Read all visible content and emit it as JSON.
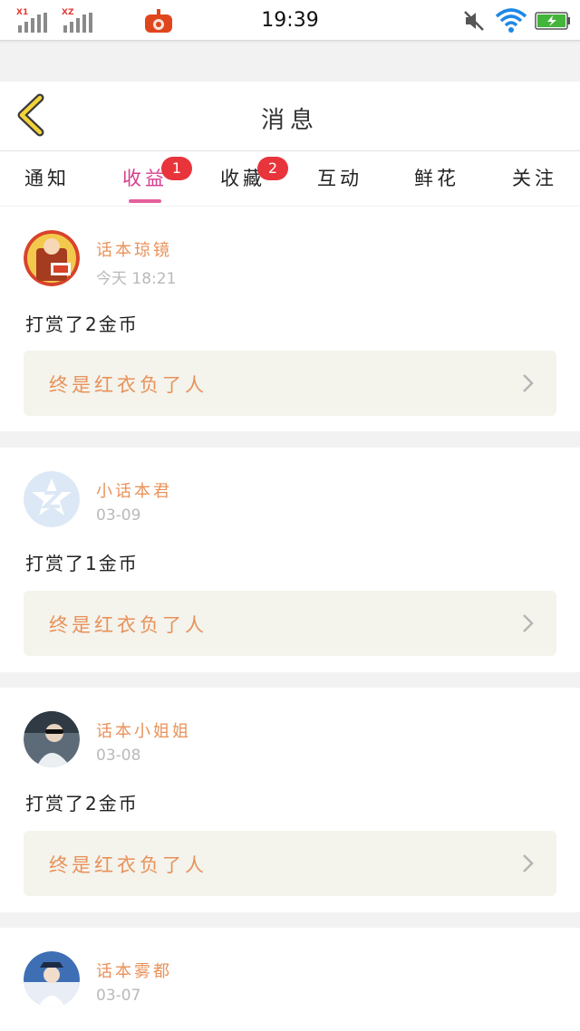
{
  "status_bar": {
    "sim1_label": "X1",
    "sim2_label": "XZ",
    "time": "19:39",
    "icons": [
      "signal-icon",
      "app-notification-icon",
      "mute-icon",
      "wifi-icon",
      "battery-charging-icon"
    ]
  },
  "header": {
    "title": "消息",
    "back_icon": "chevron-left-icon"
  },
  "tabs": [
    {
      "label": "通知",
      "active": false,
      "badge": ""
    },
    {
      "label": "收益",
      "active": true,
      "badge": "1"
    },
    {
      "label": "收藏",
      "active": false,
      "badge": "2"
    },
    {
      "label": "互动",
      "active": false,
      "badge": ""
    },
    {
      "label": "鲜花",
      "active": false,
      "badge": ""
    },
    {
      "label": "关注",
      "active": false,
      "badge": ""
    }
  ],
  "messages": [
    {
      "user": "话本琼镜",
      "time": "今天 18:21",
      "text": "打赏了2金币",
      "work": "终是红衣负了人"
    },
    {
      "user": "小话本君",
      "time": "03-09",
      "text": "打赏了1金币",
      "work": "终是红衣负了人"
    },
    {
      "user": "话本小姐姐",
      "time": "03-08",
      "text": "打赏了2金币",
      "work": "终是红衣负了人"
    },
    {
      "user": "话本雾都",
      "time": "03-07",
      "text": "",
      "work": ""
    }
  ],
  "colors": {
    "accent_pink": "#d63c8e",
    "badge_red": "#e8343b",
    "username_orange": "#e8925a",
    "work_bg": "#f4f3ec"
  }
}
